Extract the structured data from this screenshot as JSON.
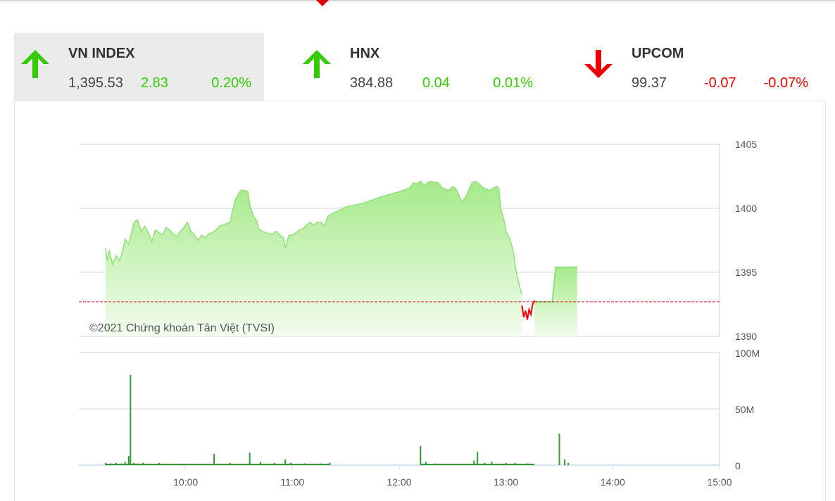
{
  "indices": [
    {
      "name": "VN INDEX",
      "value": "1,395.53",
      "change": "2.83",
      "percent": "0.20%",
      "direction": "up",
      "active": true
    },
    {
      "name": "HNX",
      "value": "384.88",
      "change": "0.04",
      "percent": "0.01%",
      "direction": "up",
      "active": false
    },
    {
      "name": "UPCOM",
      "value": "99.37",
      "change": "-0.07",
      "percent": "-0.07%",
      "direction": "down",
      "active": false
    }
  ],
  "colors": {
    "up": "#33cc00",
    "down": "#ee0000",
    "area_line": "#8fe07a",
    "volume_bar": "#339933",
    "reference": "#dd2222"
  },
  "chart_data": {
    "type": "area",
    "watermark": "©2021 Chứng khoán Tân Việt (TVSI)",
    "price": {
      "ylim": [
        1390,
        1405
      ],
      "yticks": [
        1405,
        1400,
        1395,
        1390
      ],
      "reference": 1392.7,
      "x_unit": "minutes since 09:00",
      "points": [
        [
          15,
          1396.9
        ],
        [
          16,
          1395.9
        ],
        [
          17,
          1396.7
        ],
        [
          19,
          1395.6
        ],
        [
          21,
          1396.3
        ],
        [
          23,
          1395.9
        ],
        [
          25,
          1396.9
        ],
        [
          26,
          1397.6
        ],
        [
          28,
          1397.2
        ],
        [
          30,
          1398.3
        ],
        [
          31,
          1398.9
        ],
        [
          33,
          1399.1
        ],
        [
          35,
          1398.2
        ],
        [
          37,
          1398.6
        ],
        [
          39,
          1398.1
        ],
        [
          41,
          1397.4
        ],
        [
          43,
          1398.3
        ],
        [
          45,
          1398.1
        ],
        [
          47,
          1397.9
        ],
        [
          49,
          1398.5
        ],
        [
          51,
          1398.3
        ],
        [
          53,
          1398.0
        ],
        [
          55,
          1397.8
        ],
        [
          57,
          1398.2
        ],
        [
          59,
          1398.5
        ],
        [
          61,
          1398.9
        ],
        [
          63,
          1398.2
        ],
        [
          65,
          1397.9
        ],
        [
          67,
          1397.5
        ],
        [
          69,
          1397.9
        ],
        [
          71,
          1397.7
        ],
        [
          73,
          1398.0
        ],
        [
          75,
          1398.1
        ],
        [
          77,
          1398.3
        ],
        [
          79,
          1398.6
        ],
        [
          81,
          1398.7
        ],
        [
          83,
          1398.8
        ],
        [
          85,
          1398.9
        ],
        [
          86,
          1399.6
        ],
        [
          88,
          1400.7
        ],
        [
          90,
          1401.2
        ],
        [
          91,
          1401.4
        ],
        [
          93,
          1401.4
        ],
        [
          95,
          1401.3
        ],
        [
          96,
          1400.3
        ],
        [
          98,
          1399.4
        ],
        [
          100,
          1399.0
        ],
        [
          101,
          1398.4
        ],
        [
          103,
          1398.2
        ],
        [
          105,
          1398.1
        ],
        [
          107,
          1398.0
        ],
        [
          109,
          1398.0
        ],
        [
          111,
          1398.2
        ],
        [
          113,
          1397.9
        ],
        [
          115,
          1397.7
        ],
        [
          116,
          1396.9
        ],
        [
          117,
          1397.4
        ],
        [
          118,
          1397.9
        ],
        [
          120,
          1397.9
        ],
        [
          122,
          1398.1
        ],
        [
          124,
          1398.3
        ],
        [
          126,
          1398.4
        ],
        [
          128,
          1398.7
        ],
        [
          130,
          1398.9
        ],
        [
          132,
          1398.7
        ],
        [
          134,
          1398.9
        ],
        [
          136,
          1398.9
        ],
        [
          138,
          1398.6
        ],
        [
          139,
          1399.0
        ],
        [
          140,
          1399.4
        ],
        [
          150,
          1400.1
        ],
        [
          160,
          1400.4
        ],
        [
          170,
          1400.9
        ],
        [
          180,
          1401.3
        ],
        [
          186,
          1401.6
        ],
        [
          188,
          1402.0
        ],
        [
          190,
          1401.9
        ],
        [
          192,
          1402.1
        ],
        [
          194,
          1401.8
        ],
        [
          196,
          1402.0
        ],
        [
          198,
          1402.1
        ],
        [
          200,
          1402.0
        ],
        [
          202,
          1402.0
        ],
        [
          204,
          1401.6
        ],
        [
          206,
          1401.5
        ],
        [
          208,
          1401.4
        ],
        [
          210,
          1401.7
        ],
        [
          212,
          1401.5
        ],
        [
          214,
          1400.9
        ],
        [
          215,
          1400.5
        ],
        [
          217,
          1400.8
        ],
        [
          219,
          1401.4
        ],
        [
          221,
          1402.0
        ],
        [
          223,
          1402.1
        ],
        [
          225,
          1401.9
        ],
        [
          227,
          1401.6
        ],
        [
          229,
          1401.5
        ],
        [
          231,
          1401.4
        ],
        [
          233,
          1401.6
        ],
        [
          235,
          1401.7
        ],
        [
          236,
          1401.5
        ],
        [
          237,
          1400.0
        ],
        [
          239,
          1399.0
        ],
        [
          240,
          1398.2
        ],
        [
          242,
          1397.7
        ],
        [
          244,
          1396.7
        ],
        [
          245,
          1395.7
        ],
        [
          246,
          1394.9
        ],
        [
          248,
          1393.7
        ],
        [
          249,
          1393.3
        ]
      ],
      "down_points": [
        [
          249,
          1392.4
        ],
        [
          250,
          1391.5
        ],
        [
          251,
          1392.0
        ],
        [
          252,
          1391.3
        ],
        [
          253,
          1392.1
        ],
        [
          254,
          1391.7
        ],
        [
          255,
          1392.5
        ],
        [
          256,
          1392.8
        ]
      ],
      "flat_points": [
        [
          256,
          1392.7
        ],
        [
          266,
          1392.7
        ],
        [
          268,
          1395.4
        ],
        [
          280,
          1395.4
        ]
      ]
    },
    "volume": {
      "ylim": [
        0,
        100
      ],
      "unit": "M",
      "yticks": [
        "100M",
        "50M",
        "0"
      ],
      "spikes": [
        [
          15,
          2
        ],
        [
          18,
          1.5
        ],
        [
          21,
          2
        ],
        [
          24,
          1.5
        ],
        [
          26,
          3
        ],
        [
          28,
          8
        ],
        [
          29,
          80
        ],
        [
          31,
          2
        ],
        [
          33,
          1.5
        ],
        [
          36,
          2
        ],
        [
          39,
          1
        ],
        [
          45,
          2
        ],
        [
          53,
          1
        ],
        [
          60,
          1
        ],
        [
          76,
          10
        ],
        [
          85,
          2
        ],
        [
          96,
          11
        ],
        [
          102,
          3
        ],
        [
          110,
          2
        ],
        [
          116,
          5
        ],
        [
          119,
          2
        ],
        [
          127,
          1.5
        ],
        [
          136,
          1.5
        ],
        [
          141,
          2
        ],
        [
          192,
          17
        ],
        [
          195,
          3
        ],
        [
          200,
          1.5
        ],
        [
          210,
          1
        ],
        [
          222,
          4
        ],
        [
          224,
          12
        ],
        [
          228,
          2
        ],
        [
          232,
          3
        ],
        [
          240,
          2
        ],
        [
          245,
          2
        ],
        [
          252,
          1.5
        ],
        [
          270,
          28
        ],
        [
          273,
          5
        ],
        [
          275,
          2
        ]
      ],
      "active_ranges": [
        [
          15,
          141
        ],
        [
          192,
          256
        ]
      ]
    },
    "xticks": [
      "10:00",
      "11:00",
      "12:00",
      "13:00",
      "14:00",
      "15:00"
    ],
    "x_tick_minutes": [
      60,
      120,
      180,
      240,
      300,
      360
    ]
  }
}
